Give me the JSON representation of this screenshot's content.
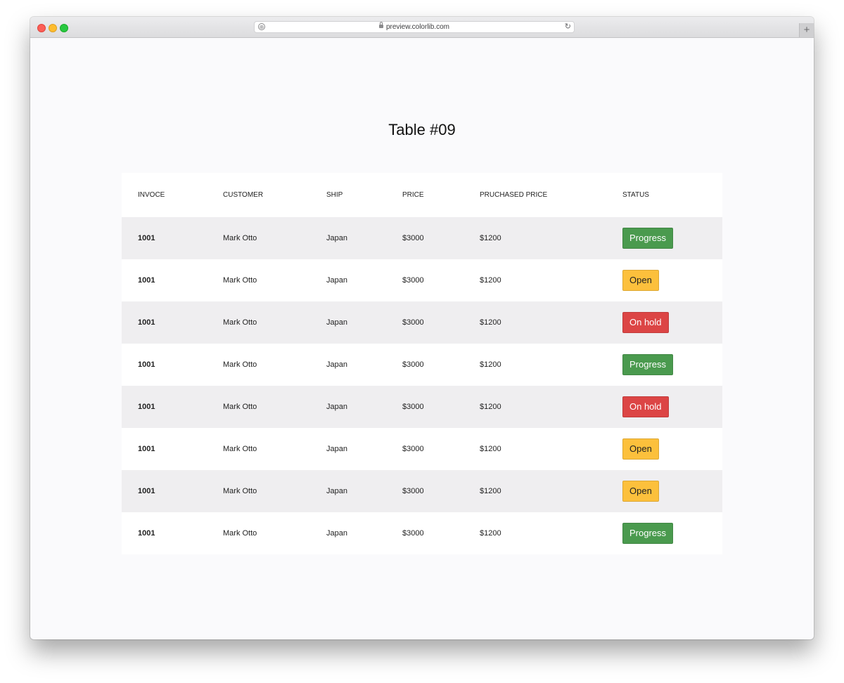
{
  "browser": {
    "url": "preview.colorlib.com",
    "new_tab_symbol": "+",
    "reload_symbol": "↻",
    "shield_symbol": "⊕"
  },
  "page": {
    "title": "Table #09"
  },
  "table": {
    "headers": [
      "INVOCE",
      "CUSTOMER",
      "SHIP",
      "PRICE",
      "PRUCHASED PRICE",
      "STATUS"
    ],
    "rows": [
      {
        "invoice": "1001",
        "customer": "Mark Otto",
        "ship": "Japan",
        "price": "$3000",
        "purchased": "$1200",
        "status": "Progress",
        "status_type": "success"
      },
      {
        "invoice": "1001",
        "customer": "Mark Otto",
        "ship": "Japan",
        "price": "$3000",
        "purchased": "$1200",
        "status": "Open",
        "status_type": "warning"
      },
      {
        "invoice": "1001",
        "customer": "Mark Otto",
        "ship": "Japan",
        "price": "$3000",
        "purchased": "$1200",
        "status": "On hold",
        "status_type": "danger"
      },
      {
        "invoice": "1001",
        "customer": "Mark Otto",
        "ship": "Japan",
        "price": "$3000",
        "purchased": "$1200",
        "status": "Progress",
        "status_type": "success"
      },
      {
        "invoice": "1001",
        "customer": "Mark Otto",
        "ship": "Japan",
        "price": "$3000",
        "purchased": "$1200",
        "status": "On hold",
        "status_type": "danger"
      },
      {
        "invoice": "1001",
        "customer": "Mark Otto",
        "ship": "Japan",
        "price": "$3000",
        "purchased": "$1200",
        "status": "Open",
        "status_type": "warning"
      },
      {
        "invoice": "1001",
        "customer": "Mark Otto",
        "ship": "Japan",
        "price": "$3000",
        "purchased": "$1200",
        "status": "Open",
        "status_type": "warning"
      },
      {
        "invoice": "1001",
        "customer": "Mark Otto",
        "ship": "Japan",
        "price": "$3000",
        "purchased": "$1200",
        "status": "Progress",
        "status_type": "success"
      }
    ]
  },
  "colors": {
    "success": "#4a9a4e",
    "warning": "#fcc03c",
    "danger": "#dc4545",
    "row_stripe": "#efeef0",
    "page_background": "#fafafc"
  }
}
